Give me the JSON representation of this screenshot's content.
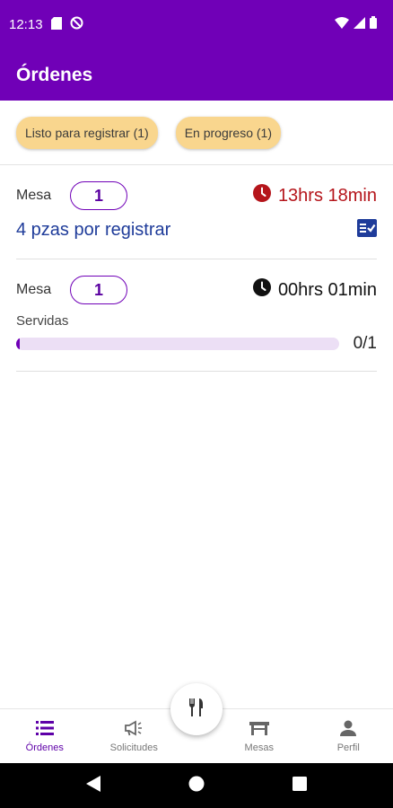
{
  "status_bar": {
    "time": "12:13"
  },
  "app_bar": {
    "title": "Órdenes"
  },
  "filters": [
    {
      "label": "Listo para registrar (1)"
    },
    {
      "label": "En progreso (1)"
    }
  ],
  "orders": [
    {
      "mesa_label": "Mesa",
      "mesa_number": "1",
      "timer": "13hrs 18min",
      "timer_color": "#b5151b",
      "pending_text": "4 pzas por registrar"
    },
    {
      "mesa_label": "Mesa",
      "mesa_number": "1",
      "timer": "00hrs 01min",
      "timer_color": "#111111",
      "served_label": "Servidas",
      "progress_fraction": 0,
      "progress_count": "0/1"
    }
  ],
  "bottom_nav": {
    "items": [
      {
        "label": "Órdenes",
        "icon": "list-icon",
        "active": true
      },
      {
        "label": "Solicitudes",
        "icon": "megaphone-icon",
        "active": false
      },
      {
        "label": "Mesas",
        "icon": "table-icon",
        "active": false
      },
      {
        "label": "Perfil",
        "icon": "person-icon",
        "active": false
      }
    ],
    "fab_icon": "fork-knife-icon"
  },
  "colors": {
    "brand": "#7000b7",
    "chip": "#f9d68e",
    "overdue": "#b5151b",
    "link": "#1f3c9a"
  }
}
